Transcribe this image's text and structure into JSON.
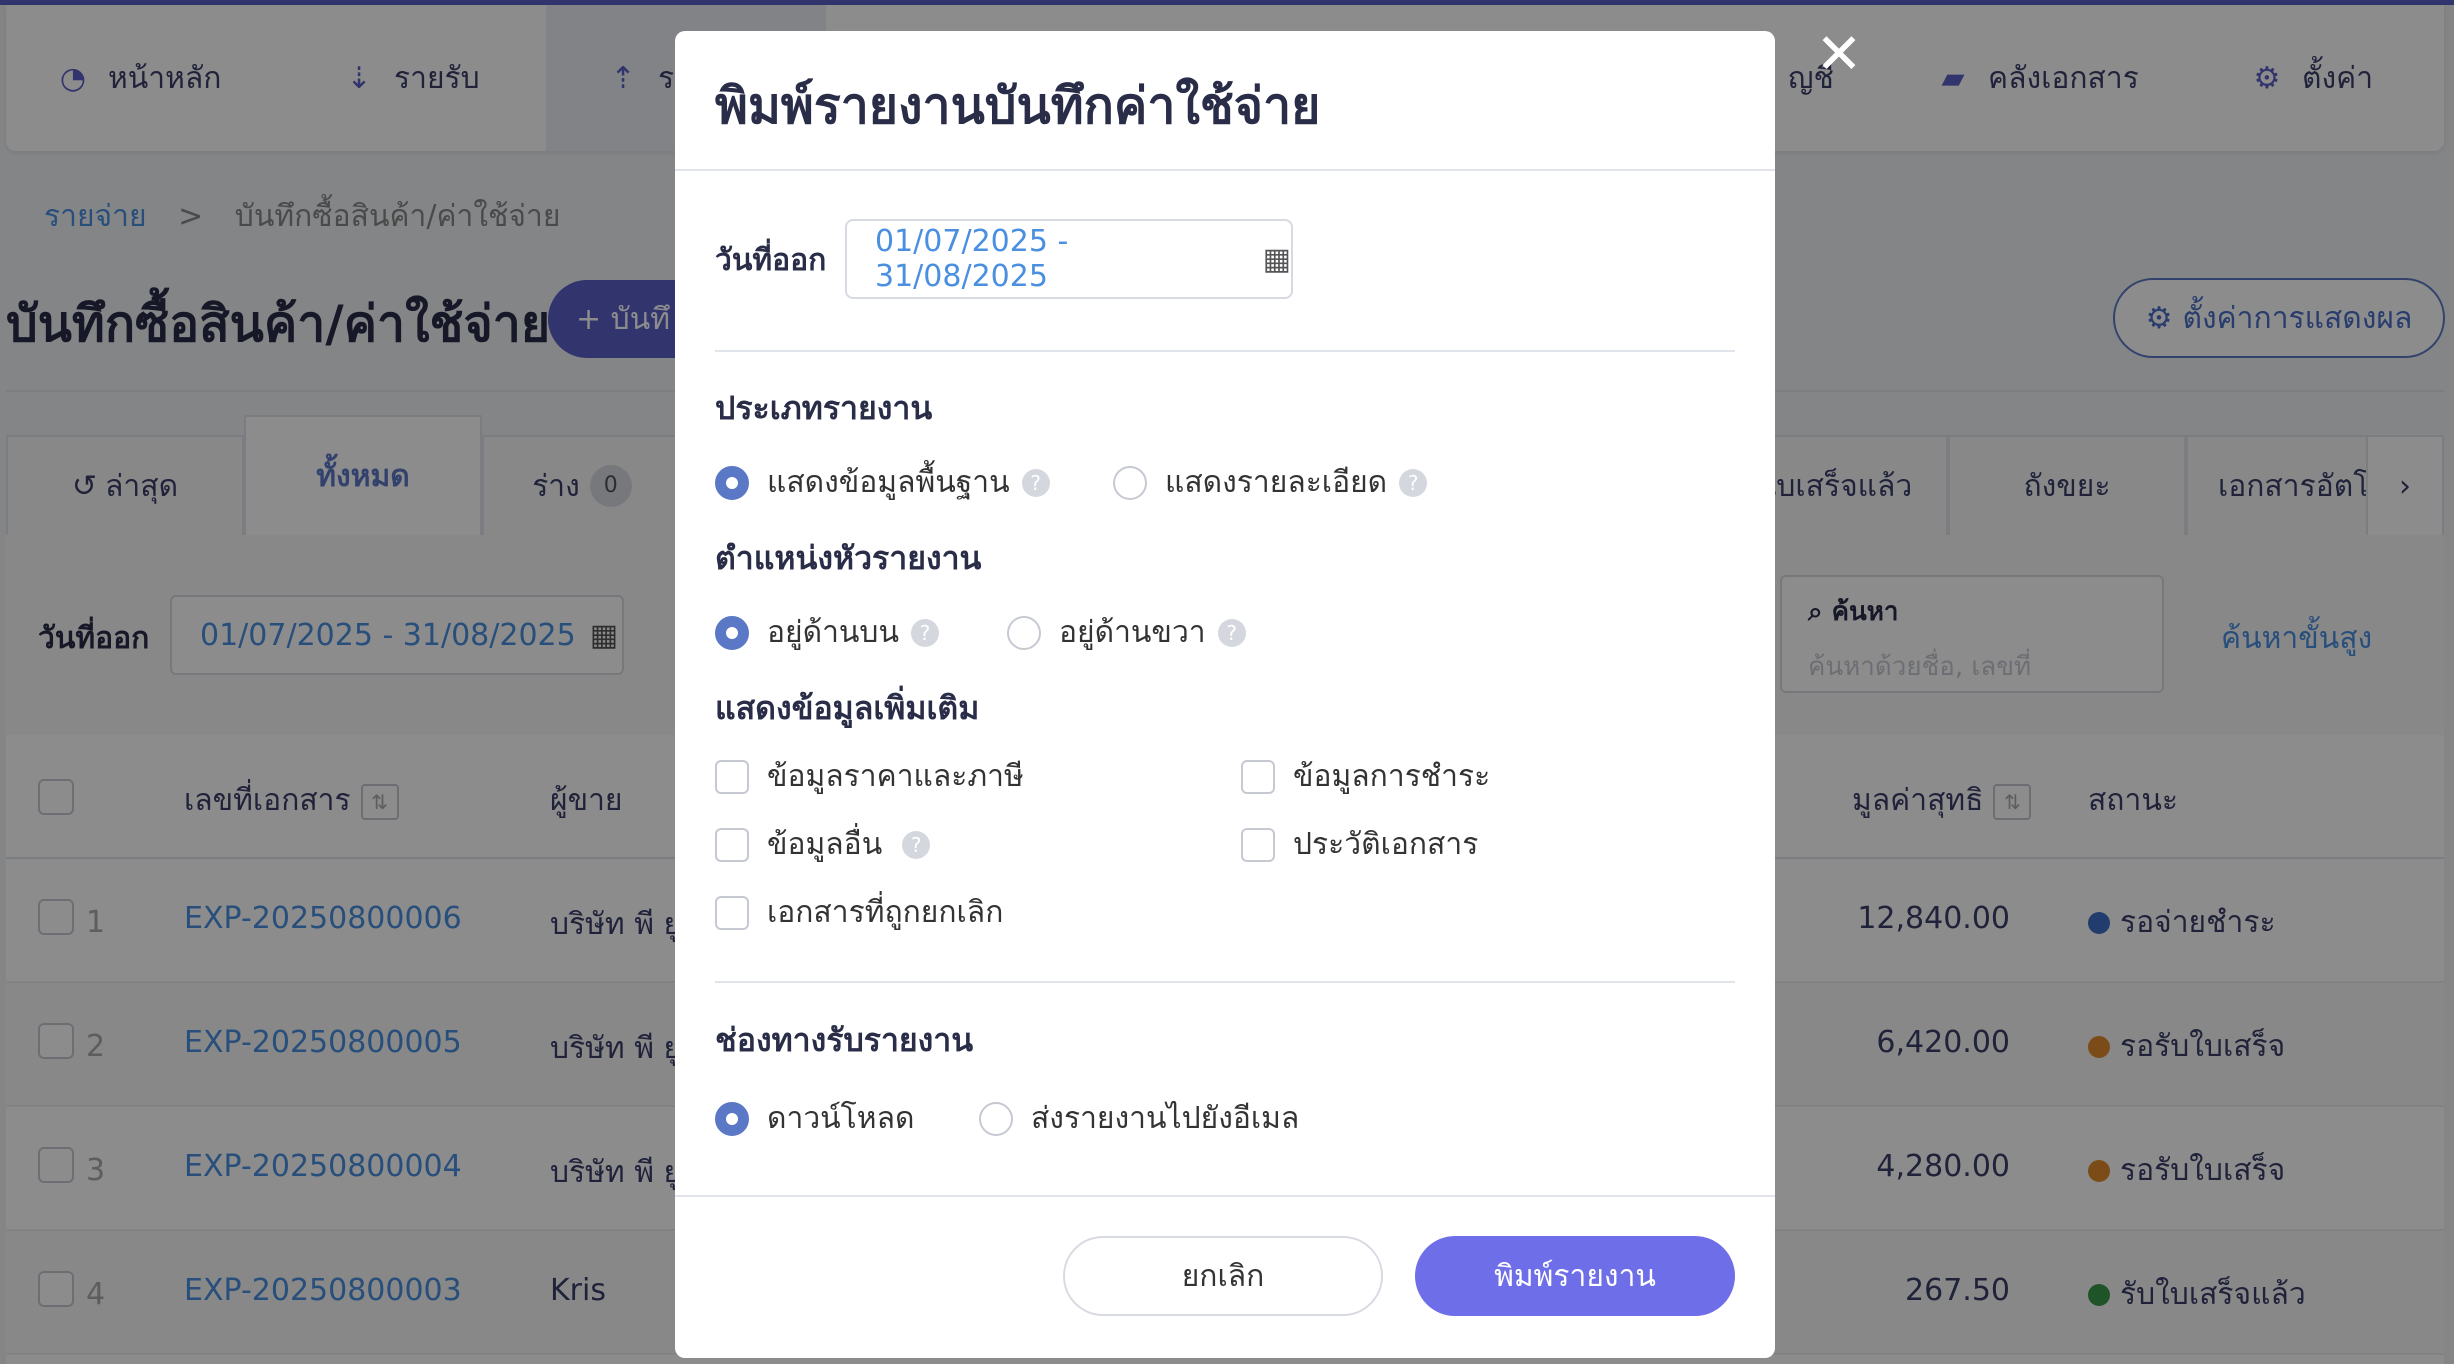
{
  "nav": {
    "items": [
      {
        "label": "หน้าหลัก",
        "icon": "dashboard-icon"
      },
      {
        "label": "รายรับ",
        "icon": "sort-down-icon"
      },
      {
        "label": "ร",
        "icon": "sort-up-icon"
      },
      {
        "label": "ญชี",
        "icon": ""
      },
      {
        "label": "คลังเอกสาร",
        "icon": "folder-icon"
      },
      {
        "label": "ตั้งค่า",
        "icon": "gear-icon"
      }
    ]
  },
  "breadcrumb": {
    "root": "รายจ่าย",
    "separator": ">",
    "current": "บันทึกซื้อสินค้า/ค่าใช้จ่าย"
  },
  "page": {
    "title": "บันทึกซื้อสินค้า/ค่าใช้จ่าย",
    "add_button": "+ บันทึ",
    "settings_button": "ตั้งค่าการแสดงผล"
  },
  "tabs": [
    {
      "label": "ล่าสุด",
      "icon": "history-icon"
    },
    {
      "label": "ทั้งหมด"
    },
    {
      "label": "ร่าง",
      "count": "0"
    },
    {
      "label": "ใบเสร็จแล้ว"
    },
    {
      "label": "ถังขยะ"
    },
    {
      "label": "เอกสารอัตโเ"
    }
  ],
  "filter": {
    "date_label": "วันที่ออก",
    "date_range": "01/07/2025 - 31/08/2025",
    "search_label": "ค้นหา",
    "search_placeholder": "ค้นหาด้วยชื่อ, เลขที่",
    "advanced_search": "ค้นหาขั้นสูง"
  },
  "table": {
    "columns": {
      "doc_no": "เลขที่เอกสาร",
      "vendor": "ผู้ขาย",
      "net": "มูลค่าสุทธิ",
      "status": "สถานะ"
    },
    "rows": [
      {
        "idx": "1",
        "doc": "EXP-20250800006",
        "vendor": "บริษัท พี ยู",
        "amount": "12,840.00",
        "status": "รอจ่ายชำระ",
        "status_color": "#3b6fc7"
      },
      {
        "idx": "2",
        "doc": "EXP-20250800005",
        "vendor": "บริษัท พี ยู",
        "amount": "6,420.00",
        "status": "รอรับใบเสร็จ",
        "status_color": "#e08a2a"
      },
      {
        "idx": "3",
        "doc": "EXP-20250800004",
        "vendor": "บริษัท พี ยู",
        "amount": "4,280.00",
        "status": "รอรับใบเสร็จ",
        "status_color": "#e08a2a"
      },
      {
        "idx": "4",
        "doc": "EXP-20250800003",
        "vendor": "Kris",
        "amount": "267.50",
        "status": "รับใบเสร็จแล้ว",
        "status_color": "#3a9a4a"
      }
    ]
  },
  "modal": {
    "title": "พิมพ์รายงานบันทึกค่าใช้จ่าย",
    "date_label": "วันที่ออก",
    "date_range": "01/07/2025 - 31/08/2025",
    "report_type": {
      "heading": "ประเภทรายงาน",
      "options": [
        "แสดงข้อมูลพื้นฐาน",
        "แสดงรายละเอียด"
      ],
      "selected": "แสดงข้อมูลพื้นฐาน"
    },
    "header_position": {
      "heading": "ตำแหน่งหัวรายงาน",
      "options": [
        "อยู่ด้านบน",
        "อยู่ด้านขวา"
      ],
      "selected": "อยู่ด้านบน"
    },
    "extra_info": {
      "heading": "แสดงข้อมูลเพิ่มเติม",
      "options": [
        "ข้อมูลราคาและภาษี",
        "ข้อมูลการชำระ",
        "ข้อมูลอื่น",
        "ประวัติเอกสาร",
        "เอกสารที่ถูกยกเลิก"
      ]
    },
    "channel": {
      "heading": "ช่องทางรับรายงาน",
      "options": [
        "ดาวน์โหลด",
        "ส่งรายงานไปยังอีเมล"
      ],
      "selected": "ดาวน์โหลด"
    },
    "cancel_button": "ยกเลิก",
    "print_button": "พิมพ์รายงาน"
  },
  "colors": {
    "accent": "#5b5fc7",
    "link": "#4a8fe0",
    "print_button": "#6d6ee8"
  }
}
